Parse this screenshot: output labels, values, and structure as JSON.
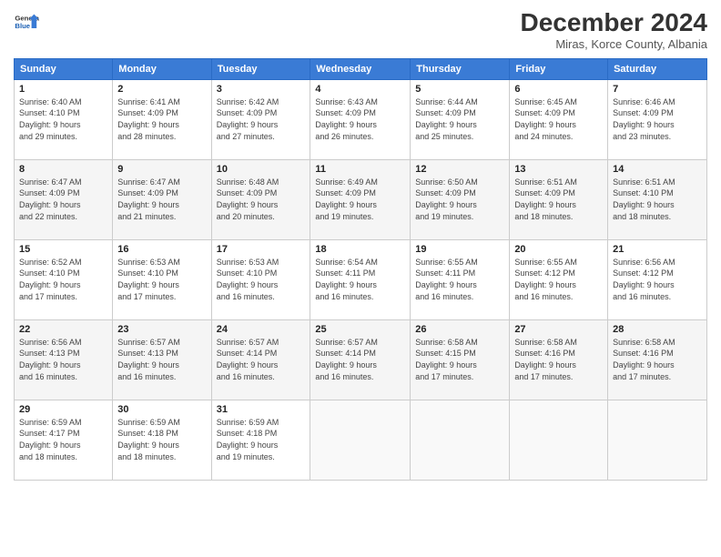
{
  "header": {
    "logo_line1": "General",
    "logo_line2": "Blue",
    "month_title": "December 2024",
    "subtitle": "Miras, Korce County, Albania"
  },
  "days_of_week": [
    "Sunday",
    "Monday",
    "Tuesday",
    "Wednesday",
    "Thursday",
    "Friday",
    "Saturday"
  ],
  "weeks": [
    [
      {
        "day": "1",
        "info": "Sunrise: 6:40 AM\nSunset: 4:10 PM\nDaylight: 9 hours\nand 29 minutes."
      },
      {
        "day": "2",
        "info": "Sunrise: 6:41 AM\nSunset: 4:09 PM\nDaylight: 9 hours\nand 28 minutes."
      },
      {
        "day": "3",
        "info": "Sunrise: 6:42 AM\nSunset: 4:09 PM\nDaylight: 9 hours\nand 27 minutes."
      },
      {
        "day": "4",
        "info": "Sunrise: 6:43 AM\nSunset: 4:09 PM\nDaylight: 9 hours\nand 26 minutes."
      },
      {
        "day": "5",
        "info": "Sunrise: 6:44 AM\nSunset: 4:09 PM\nDaylight: 9 hours\nand 25 minutes."
      },
      {
        "day": "6",
        "info": "Sunrise: 6:45 AM\nSunset: 4:09 PM\nDaylight: 9 hours\nand 24 minutes."
      },
      {
        "day": "7",
        "info": "Sunrise: 6:46 AM\nSunset: 4:09 PM\nDaylight: 9 hours\nand 23 minutes."
      }
    ],
    [
      {
        "day": "8",
        "info": "Sunrise: 6:47 AM\nSunset: 4:09 PM\nDaylight: 9 hours\nand 22 minutes."
      },
      {
        "day": "9",
        "info": "Sunrise: 6:47 AM\nSunset: 4:09 PM\nDaylight: 9 hours\nand 21 minutes."
      },
      {
        "day": "10",
        "info": "Sunrise: 6:48 AM\nSunset: 4:09 PM\nDaylight: 9 hours\nand 20 minutes."
      },
      {
        "day": "11",
        "info": "Sunrise: 6:49 AM\nSunset: 4:09 PM\nDaylight: 9 hours\nand 19 minutes."
      },
      {
        "day": "12",
        "info": "Sunrise: 6:50 AM\nSunset: 4:09 PM\nDaylight: 9 hours\nand 19 minutes."
      },
      {
        "day": "13",
        "info": "Sunrise: 6:51 AM\nSunset: 4:09 PM\nDaylight: 9 hours\nand 18 minutes."
      },
      {
        "day": "14",
        "info": "Sunrise: 6:51 AM\nSunset: 4:10 PM\nDaylight: 9 hours\nand 18 minutes."
      }
    ],
    [
      {
        "day": "15",
        "info": "Sunrise: 6:52 AM\nSunset: 4:10 PM\nDaylight: 9 hours\nand 17 minutes."
      },
      {
        "day": "16",
        "info": "Sunrise: 6:53 AM\nSunset: 4:10 PM\nDaylight: 9 hours\nand 17 minutes."
      },
      {
        "day": "17",
        "info": "Sunrise: 6:53 AM\nSunset: 4:10 PM\nDaylight: 9 hours\nand 16 minutes."
      },
      {
        "day": "18",
        "info": "Sunrise: 6:54 AM\nSunset: 4:11 PM\nDaylight: 9 hours\nand 16 minutes."
      },
      {
        "day": "19",
        "info": "Sunrise: 6:55 AM\nSunset: 4:11 PM\nDaylight: 9 hours\nand 16 minutes."
      },
      {
        "day": "20",
        "info": "Sunrise: 6:55 AM\nSunset: 4:12 PM\nDaylight: 9 hours\nand 16 minutes."
      },
      {
        "day": "21",
        "info": "Sunrise: 6:56 AM\nSunset: 4:12 PM\nDaylight: 9 hours\nand 16 minutes."
      }
    ],
    [
      {
        "day": "22",
        "info": "Sunrise: 6:56 AM\nSunset: 4:13 PM\nDaylight: 9 hours\nand 16 minutes."
      },
      {
        "day": "23",
        "info": "Sunrise: 6:57 AM\nSunset: 4:13 PM\nDaylight: 9 hours\nand 16 minutes."
      },
      {
        "day": "24",
        "info": "Sunrise: 6:57 AM\nSunset: 4:14 PM\nDaylight: 9 hours\nand 16 minutes."
      },
      {
        "day": "25",
        "info": "Sunrise: 6:57 AM\nSunset: 4:14 PM\nDaylight: 9 hours\nand 16 minutes."
      },
      {
        "day": "26",
        "info": "Sunrise: 6:58 AM\nSunset: 4:15 PM\nDaylight: 9 hours\nand 17 minutes."
      },
      {
        "day": "27",
        "info": "Sunrise: 6:58 AM\nSunset: 4:16 PM\nDaylight: 9 hours\nand 17 minutes."
      },
      {
        "day": "28",
        "info": "Sunrise: 6:58 AM\nSunset: 4:16 PM\nDaylight: 9 hours\nand 17 minutes."
      }
    ],
    [
      {
        "day": "29",
        "info": "Sunrise: 6:59 AM\nSunset: 4:17 PM\nDaylight: 9 hours\nand 18 minutes."
      },
      {
        "day": "30",
        "info": "Sunrise: 6:59 AM\nSunset: 4:18 PM\nDaylight: 9 hours\nand 18 minutes."
      },
      {
        "day": "31",
        "info": "Sunrise: 6:59 AM\nSunset: 4:18 PM\nDaylight: 9 hours\nand 19 minutes."
      },
      {
        "day": "",
        "info": ""
      },
      {
        "day": "",
        "info": ""
      },
      {
        "day": "",
        "info": ""
      },
      {
        "day": "",
        "info": ""
      }
    ]
  ]
}
